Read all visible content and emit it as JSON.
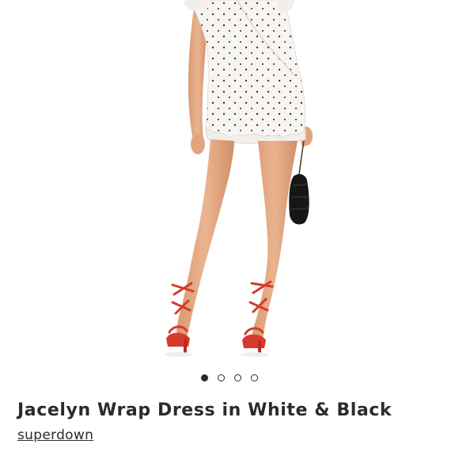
{
  "listing": {
    "title": "Jacelyn Wrap Dress in White & Black",
    "brand": "superdown"
  },
  "carousel": {
    "total_images": 4,
    "active_index": 0
  },
  "image": {
    "subject": "model-wearing-white-polka-dot-wrap-dress-with-red-lace-up-heels-and-black-clutch"
  },
  "colors": {
    "text": "#2b2b2b",
    "dot_active": "#2a2a2a",
    "dress": "#f7f5f2",
    "heels": "#d63a2e",
    "clutch": "#161616"
  }
}
